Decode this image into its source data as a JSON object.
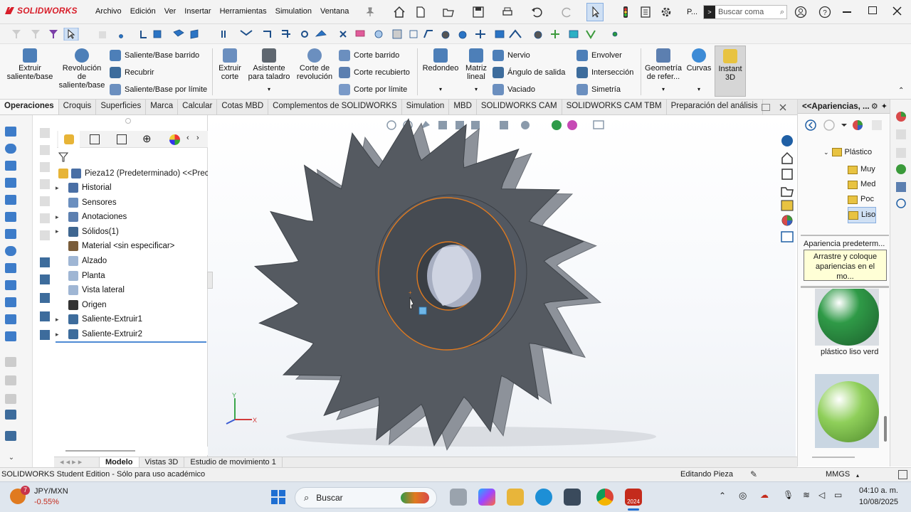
{
  "app": {
    "logo_text": "SOLIDWORKS",
    "menu": [
      "Archivo",
      "Edición",
      "Ver",
      "Insertar",
      "Herramientas",
      "Simulation",
      "Ventana"
    ],
    "search_placeholder": "Buscar coma",
    "p_label": "P..."
  },
  "ribbon": {
    "extrude_boss": "Extruir saliente/base",
    "revolve_boss": "Revolución de saliente/base",
    "swept_boss": "Saliente/Base barrido",
    "loft": "Recubrir",
    "boundary_boss": "Saliente/Base por límite",
    "extrude_cut": "Extruir corte",
    "hole_wizard": "Asistente para taladro",
    "revolve_cut": "Corte de revolución",
    "swept_cut": "Corte barrido",
    "lofted_cut": "Corte recubierto",
    "boundary_cut": "Corte por límite",
    "fillet": "Redondeo",
    "linear_pattern": "Matriz lineal",
    "rib": "Nervio",
    "draft": "Ángulo de salida",
    "shell": "Vaciado",
    "wrap": "Envolver",
    "intersect": "Intersección",
    "mirror": "Simetría",
    "ref_geometry": "Geometría de refer...",
    "curves": "Curvas",
    "instant3d": "Instant 3D"
  },
  "tabs": [
    "Operaciones",
    "Croquis",
    "Superficies",
    "Marca",
    "Calcular",
    "Cotas MBD",
    "Complementos de SOLIDWORKS",
    "Simulation",
    "MBD",
    "SOLIDWORKS CAM",
    "SOLIDWORKS CAM TBM",
    "Preparación del análisis"
  ],
  "tree": {
    "root": "Pieza12 (Predeterminado) <<Prec",
    "items": [
      {
        "label": "Historial",
        "expandable": true,
        "icon_color": "#4a6fa5"
      },
      {
        "label": "Sensores",
        "expandable": false,
        "icon_color": "#6b8fbf"
      },
      {
        "label": "Anotaciones",
        "expandable": true,
        "icon_color": "#5c7fb0"
      },
      {
        "label": "Sólidos(1)",
        "expandable": true,
        "icon_color": "#3f6690"
      },
      {
        "label": "Material <sin especificar>",
        "expandable": false,
        "icon_color": "#7a5d3a"
      },
      {
        "label": "Alzado",
        "expandable": false,
        "icon_color": "#9fb6d4"
      },
      {
        "label": "Planta",
        "expandable": false,
        "icon_color": "#9fb6d4"
      },
      {
        "label": "Vista lateral",
        "expandable": false,
        "icon_color": "#9fb6d4"
      },
      {
        "label": "Origen",
        "expandable": false,
        "icon_color": "#333333"
      },
      {
        "label": "Saliente-Extruir1",
        "expandable": true,
        "icon_color": "#3d6c9c"
      },
      {
        "label": "Saliente-Extruir2",
        "expandable": true,
        "icon_color": "#3d6c9c"
      }
    ]
  },
  "right_panel": {
    "title": "<<Apariencias, ...",
    "folder": "Plástico",
    "subfolders": [
      "Muy",
      "Med",
      "Poc",
      "Liso"
    ],
    "default_label": "Apariencia predeterm...",
    "tooltip": "Arrastre y coloque apariencias en el mo...",
    "swatch1_label": "plástico liso verd",
    "swatch1_color": "#2f9a47",
    "swatch2_color": "#8fcf5a"
  },
  "bottom_tabs": [
    "Modelo",
    "Vistas 3D",
    "Estudio de movimiento 1"
  ],
  "status": {
    "left": "SOLIDWORKS Student Edition - Sólo para uso académico",
    "mode": "Editando Pieza",
    "units": "MMGS"
  },
  "taskbar": {
    "ticker": "JPY/MXN",
    "ticker_change": "-0.55%",
    "ticker_badge": "7",
    "search": "Buscar",
    "time": "04:10 a. m.",
    "date": "10/08/2025",
    "sw_badge": "2024"
  },
  "axes": {
    "y": "Y",
    "x": "X"
  },
  "colors": {
    "brand": "#d81e2a",
    "part": "#555a61",
    "selection": "#e07a1f",
    "accent": "#1f6fb5"
  }
}
